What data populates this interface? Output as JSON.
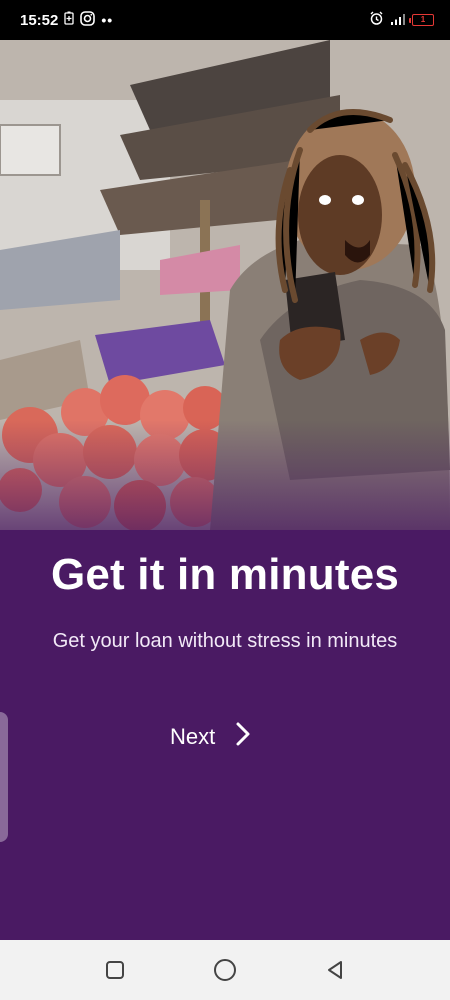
{
  "status_bar": {
    "time": "15:52",
    "battery_level": "1",
    "icons": [
      "battery-saver-icon",
      "instagram-icon",
      "more-dots-icon",
      "alarm-icon",
      "signal-icon",
      "battery-icon"
    ],
    "dots": "••"
  },
  "hero": {
    "image_description": "woman reacting excitedly to phone at a market stall with tomatoes"
  },
  "onboarding": {
    "title": "Get it in minutes",
    "subtitle": "Get your loan without stress in minutes",
    "next_label": "Next",
    "next_icon": "chevron-right-icon"
  },
  "navbar": {
    "buttons": [
      "recent-apps-button",
      "home-button",
      "back-button"
    ]
  },
  "colors": {
    "background": "#4a1a63",
    "status_bar": "#000000",
    "navbar": "#f2f2f2",
    "text": "#ffffff"
  }
}
